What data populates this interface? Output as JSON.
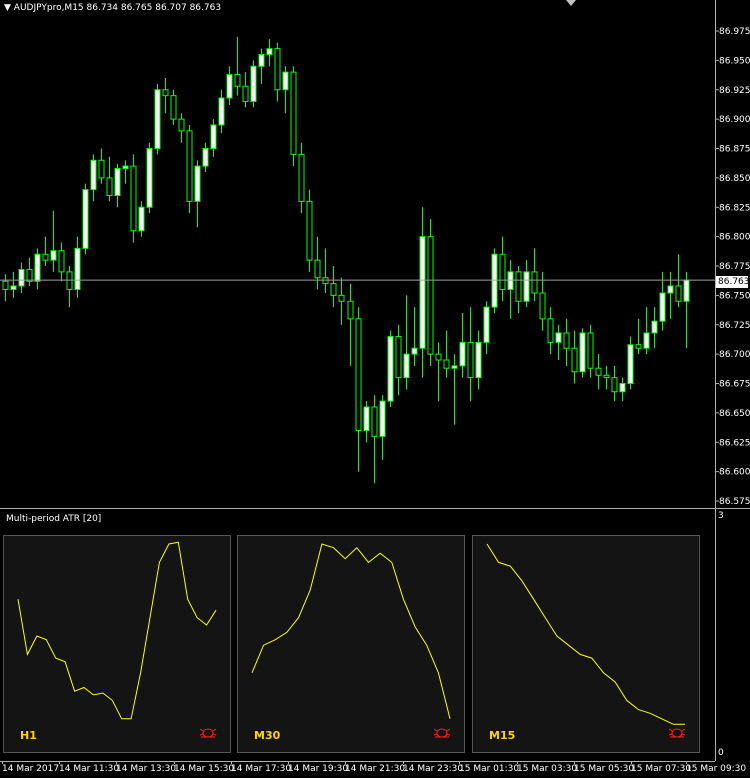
{
  "window": {
    "symbol_label": "AUDJPYpro,M15  86.734 86.765 86.707 86.763",
    "current_price": "86.763"
  },
  "chart_data": {
    "type": "candlestick",
    "symbol": "AUDJPYpro",
    "timeframe": "M15",
    "ohlc_header": {
      "open": 86.734,
      "high": 86.765,
      "low": 86.707,
      "close": 86.763
    },
    "ylim": [
      86.575,
      86.975
    ],
    "y_ticks": [
      "86.975",
      "86.950",
      "86.925",
      "86.900",
      "86.875",
      "86.850",
      "86.825",
      "86.800",
      "86.775",
      "86.750",
      "86.725",
      "86.700",
      "86.675",
      "86.650",
      "86.625",
      "86.600",
      "86.575"
    ],
    "x_ticks": [
      "14 Mar 2017",
      "14 Mar 11:30",
      "14 Mar 13:30",
      "14 Mar 15:30",
      "14 Mar 17:30",
      "14 Mar 19:30",
      "14 Mar 21:30",
      "14 Mar 23:30",
      "15 Mar 01:30",
      "15 Mar 03:30",
      "15 Mar 05:30",
      "15 Mar 07:30",
      "15 Mar 09:30"
    ],
    "current_price": 86.763,
    "candles": [
      [
        86.762,
        86.768,
        86.745,
        86.755
      ],
      [
        86.755,
        86.77,
        86.748,
        86.758
      ],
      [
        86.758,
        86.778,
        86.752,
        86.772
      ],
      [
        86.772,
        86.782,
        86.758,
        86.762
      ],
      [
        86.762,
        86.79,
        86.755,
        86.785
      ],
      [
        86.785,
        86.8,
        86.775,
        86.78
      ],
      [
        86.78,
        86.822,
        86.77,
        86.788
      ],
      [
        86.788,
        86.795,
        86.762,
        86.77
      ],
      [
        86.77,
        86.775,
        86.74,
        86.755
      ],
      [
        86.755,
        86.8,
        86.748,
        86.79
      ],
      [
        86.79,
        86.845,
        86.785,
        86.84
      ],
      [
        86.84,
        86.87,
        86.83,
        86.865
      ],
      [
        86.865,
        86.875,
        86.845,
        86.85
      ],
      [
        86.85,
        86.868,
        86.83,
        86.835
      ],
      [
        86.835,
        86.862,
        86.825,
        86.858
      ],
      [
        86.858,
        86.865,
        86.845,
        86.86
      ],
      [
        86.86,
        86.87,
        86.795,
        86.805
      ],
      [
        86.805,
        86.83,
        86.8,
        86.825
      ],
      [
        86.825,
        86.88,
        86.82,
        86.875
      ],
      [
        86.875,
        86.93,
        86.87,
        86.925
      ],
      [
        86.925,
        86.935,
        86.905,
        86.92
      ],
      [
        86.92,
        86.925,
        86.895,
        86.9
      ],
      [
        86.9,
        86.905,
        86.88,
        86.89
      ],
      [
        86.89,
        86.895,
        86.82,
        86.83
      ],
      [
        86.83,
        86.865,
        86.808,
        86.86
      ],
      [
        86.86,
        86.88,
        86.855,
        86.875
      ],
      [
        86.875,
        86.9,
        86.868,
        86.895
      ],
      [
        86.895,
        86.925,
        86.888,
        86.918
      ],
      [
        86.918,
        86.945,
        86.912,
        86.938
      ],
      [
        86.938,
        86.97,
        86.92,
        86.928
      ],
      [
        86.928,
        86.94,
        86.91,
        86.915
      ],
      [
        86.915,
        86.95,
        86.91,
        86.945
      ],
      [
        86.945,
        86.96,
        86.93,
        86.955
      ],
      [
        86.955,
        86.968,
        86.945,
        86.96
      ],
      [
        86.96,
        86.965,
        86.915,
        86.925
      ],
      [
        86.925,
        86.945,
        86.905,
        86.94
      ],
      [
        86.94,
        86.945,
        86.86,
        86.87
      ],
      [
        86.87,
        86.88,
        86.82,
        86.83
      ],
      [
        86.83,
        86.84,
        86.77,
        86.78
      ],
      [
        86.78,
        86.8,
        86.755,
        86.765
      ],
      [
        86.765,
        86.79,
        86.752,
        86.76
      ],
      [
        86.76,
        86.775,
        86.74,
        86.75
      ],
      [
        86.75,
        86.765,
        86.725,
        86.745
      ],
      [
        86.745,
        86.76,
        86.69,
        86.73
      ],
      [
        86.73,
        86.74,
        86.6,
        86.635
      ],
      [
        86.635,
        86.66,
        86.625,
        86.655
      ],
      [
        86.655,
        86.665,
        86.59,
        86.63
      ],
      [
        86.63,
        86.665,
        86.61,
        86.66
      ],
      [
        86.66,
        86.72,
        86.655,
        86.715
      ],
      [
        86.715,
        86.725,
        86.665,
        86.68
      ],
      [
        86.68,
        86.75,
        86.67,
        86.7
      ],
      [
        86.7,
        86.74,
        86.69,
        86.705
      ],
      [
        86.705,
        86.825,
        86.68,
        86.8
      ],
      [
        86.8,
        86.815,
        86.69,
        86.7
      ],
      [
        86.7,
        86.71,
        86.66,
        86.695
      ],
      [
        86.695,
        86.72,
        86.68,
        86.688
      ],
      [
        86.688,
        86.7,
        86.64,
        86.69
      ],
      [
        86.69,
        86.735,
        86.68,
        86.71
      ],
      [
        86.71,
        86.74,
        86.66,
        86.68
      ],
      [
        86.68,
        86.72,
        86.67,
        86.71
      ],
      [
        86.71,
        86.745,
        86.7,
        86.74
      ],
      [
        86.74,
        86.79,
        86.735,
        86.785
      ],
      [
        86.785,
        86.8,
        86.745,
        86.755
      ],
      [
        86.755,
        86.78,
        86.73,
        86.77
      ],
      [
        86.77,
        86.775,
        86.735,
        86.745
      ],
      [
        86.745,
        86.78,
        86.74,
        86.77
      ],
      [
        86.77,
        86.79,
        86.745,
        86.752
      ],
      [
        86.752,
        86.77,
        86.72,
        86.73
      ],
      [
        86.73,
        86.74,
        86.7,
        86.71
      ],
      [
        86.71,
        86.725,
        86.695,
        86.718
      ],
      [
        86.718,
        86.73,
        86.69,
        86.705
      ],
      [
        86.705,
        86.72,
        86.675,
        86.685
      ],
      [
        86.685,
        86.722,
        86.68,
        86.718
      ],
      [
        86.718,
        86.725,
        86.68,
        86.688
      ],
      [
        86.688,
        86.7,
        86.67,
        86.682
      ],
      [
        86.682,
        86.69,
        86.67,
        86.68
      ],
      [
        86.68,
        86.69,
        86.66,
        86.668
      ],
      [
        86.668,
        86.68,
        86.66,
        86.675
      ],
      [
        86.675,
        86.715,
        86.67,
        86.708
      ],
      [
        86.708,
        86.73,
        86.7,
        86.705
      ],
      [
        86.705,
        86.74,
        86.7,
        86.718
      ],
      [
        86.718,
        86.74,
        86.705,
        86.728
      ],
      [
        86.728,
        86.77,
        86.72,
        86.752
      ],
      [
        86.752,
        86.77,
        86.73,
        86.758
      ],
      [
        86.758,
        86.785,
        86.74,
        86.745
      ],
      [
        86.745,
        86.77,
        86.705,
        86.763
      ]
    ]
  },
  "indicator": {
    "label": "Multi-period ATR [20]",
    "scale_max": "3",
    "scale_min": "0",
    "panels": [
      {
        "label": "H1",
        "values": [
          0.7,
          0.4,
          0.5,
          0.48,
          0.38,
          0.36,
          0.2,
          0.22,
          0.18,
          0.19,
          0.15,
          0.05,
          0.05,
          0.3,
          0.6,
          0.9,
          1.0,
          1.01,
          0.7,
          0.6,
          0.56,
          0.64
        ]
      },
      {
        "label": "M30",
        "values": [
          0.3,
          0.45,
          0.48,
          0.52,
          0.6,
          0.75,
          1.0,
          0.98,
          0.92,
          0.98,
          0.9,
          0.95,
          0.9,
          0.7,
          0.55,
          0.45,
          0.3,
          0.05
        ]
      },
      {
        "label": "M15",
        "values": [
          1.0,
          0.9,
          0.88,
          0.8,
          0.7,
          0.6,
          0.5,
          0.45,
          0.4,
          0.38,
          0.3,
          0.25,
          0.15,
          0.1,
          0.08,
          0.05,
          0.02,
          0.02
        ]
      }
    ],
    "line_color": "#ffff00"
  },
  "colors": {
    "bull_fill": "#ffffff",
    "bull_border": "#00ff00",
    "bear_fill": "#000000",
    "bear_border": "#00ff00",
    "wick": "#00ff00",
    "bg": "#000000",
    "grid_axis": "#b0b0b0",
    "panel_label": "#ffd400",
    "bug_icon": "#ff2020"
  }
}
